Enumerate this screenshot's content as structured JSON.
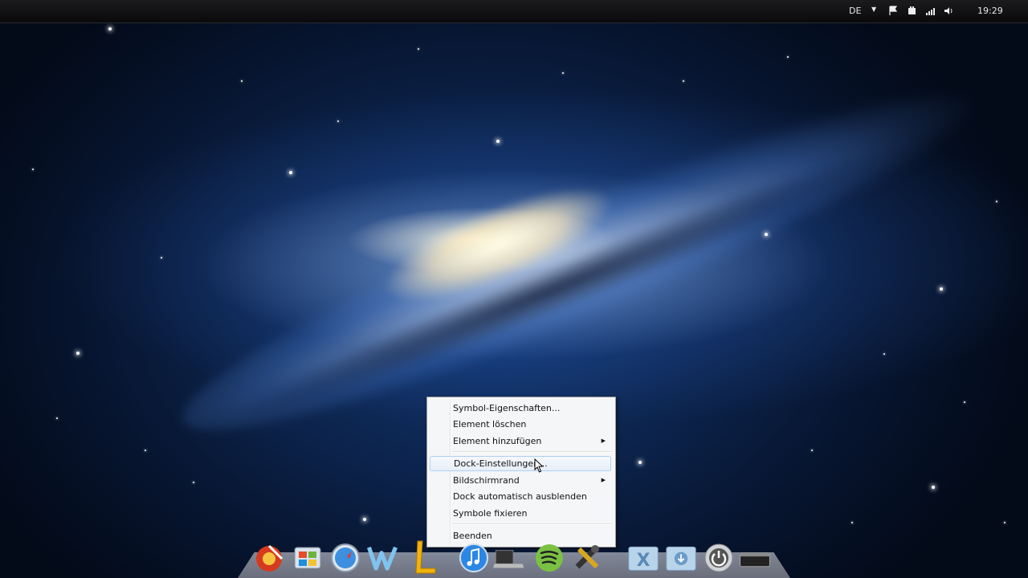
{
  "topbar": {
    "language": "DE",
    "dropdown_arrow": "▼",
    "tray_icons": [
      "flag-icon",
      "network-device-icon",
      "signal-bars-icon",
      "volume-icon"
    ],
    "clock": "19:29"
  },
  "context_menu": {
    "items": [
      {
        "label": "Symbol-Eigenschaften...",
        "submenu": false,
        "highlighted": false
      },
      {
        "label": "Element löschen",
        "submenu": false,
        "highlighted": false
      },
      {
        "label": "Element hinzufügen",
        "submenu": true,
        "highlighted": false
      },
      {
        "label": "Dock-Einstellungen...",
        "submenu": false,
        "highlighted": true
      },
      {
        "label": "Bildschirmrand",
        "submenu": true,
        "highlighted": false
      },
      {
        "label": "Dock automatisch ausblenden",
        "submenu": false,
        "highlighted": false
      },
      {
        "label": "Symbole fixieren",
        "submenu": false,
        "highlighted": false
      },
      {
        "label": "Beenden",
        "submenu": false,
        "highlighted": false
      }
    ],
    "submenu_arrow": "▶"
  },
  "dock": {
    "items": [
      {
        "icon": "browser-icon"
      },
      {
        "icon": "windows-icon"
      },
      {
        "icon": "safari-compass-icon"
      },
      {
        "icon": "word-icon"
      },
      {
        "icon": "pen-icon"
      },
      {
        "icon": "itunes-icon"
      },
      {
        "icon": "laptop-icon"
      },
      {
        "icon": "spotify-icon"
      },
      {
        "icon": "tools-icon"
      },
      {
        "icon": "recycle-bin-icon"
      },
      {
        "icon": "downloads-folder-icon"
      },
      {
        "icon": "power-icon"
      },
      {
        "icon": "terminal-icon"
      }
    ]
  },
  "colors": {
    "menu_background": "#f5f6f7",
    "menu_highlight": "#e7eef8",
    "topbar": "#111113"
  }
}
